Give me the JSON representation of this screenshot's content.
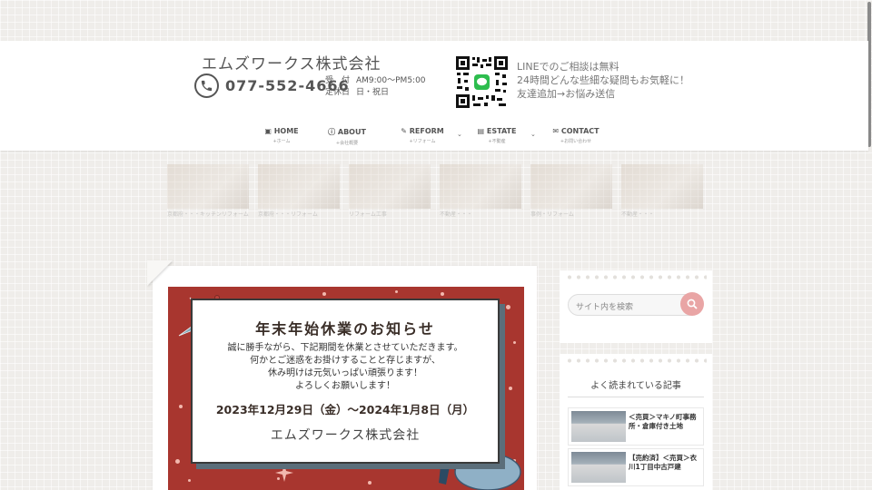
{
  "header": {
    "company_name": "エムズワークス株式会社",
    "phone": "077-552-4666",
    "hours_label": "受　付",
    "hours_value": "AM9:00〜PM5:00",
    "closed_label": "定休日",
    "closed_value": "日・祝日",
    "line_info": [
      "LINEでのご相談は無料",
      "24時間どんな些細な疑問もお気軽に！",
      "友達追加→お悩み送信"
    ]
  },
  "nav": {
    "items": [
      {
        "label": "HOME",
        "sub": "ホーム",
        "icon": "home-icon"
      },
      {
        "label": "ABOUT",
        "sub": "会社概要",
        "icon": "question-icon"
      },
      {
        "label": "REFORM",
        "sub": "リフォーム",
        "icon": "wrench-icon"
      },
      {
        "label": "ESTATE",
        "sub": "不動産",
        "icon": "building-icon"
      },
      {
        "label": "CONTACT",
        "sub": "お問い合わせ",
        "icon": "mail-icon"
      }
    ]
  },
  "carousel": {
    "items": [
      {
        "title": "京都府・・・キッチンリフォーム"
      },
      {
        "title": "京都府・・・リフォーム"
      },
      {
        "title": "リフォーム工事"
      },
      {
        "title": "不動産・・・"
      },
      {
        "title": "事例・リフォーム"
      },
      {
        "title": "不動産・・・"
      }
    ]
  },
  "notice": {
    "title": "年末年始休業のお知らせ",
    "lines": [
      "誠に勝手ながら、下記期間を休業とさせていただきます。",
      "何かとご迷惑をお掛けすることと存じますが、",
      "休み明けは元気いっぱい頑張ります！",
      "よろしくお願いします！"
    ],
    "period": "2023年12月29日（金）〜2024年1月8日（月）",
    "signature": "エムズワークス株式会社"
  },
  "sidebar": {
    "search_placeholder": "サイト内を検索",
    "popular_title": "よく読まれている記事",
    "popular": [
      {
        "title": "＜売買＞マキノ町事務所・倉庫付き土地"
      },
      {
        "title": "【売約済】＜売買＞衣川1丁目中古戸建"
      }
    ]
  }
}
